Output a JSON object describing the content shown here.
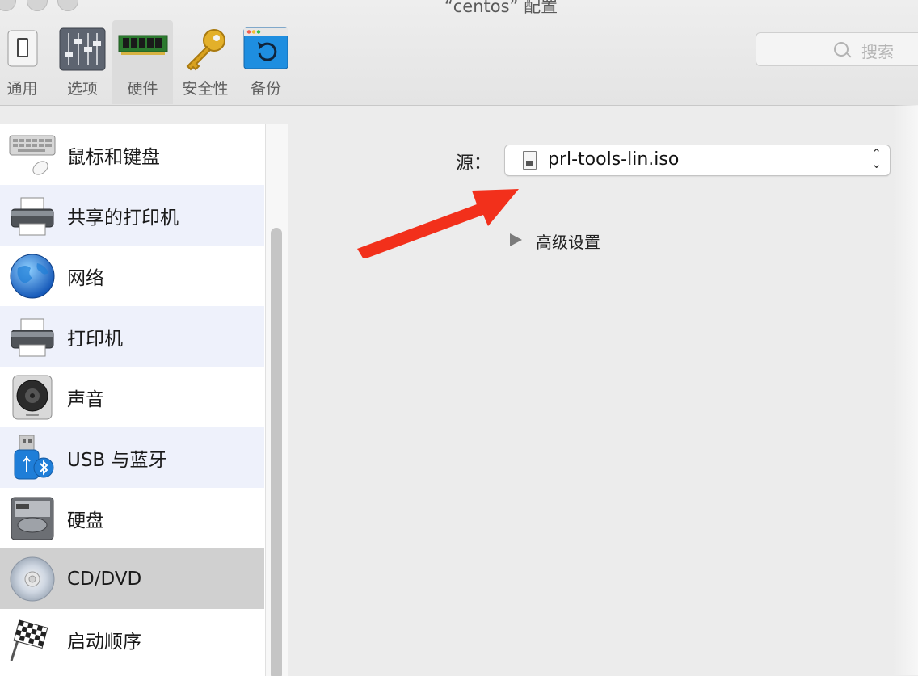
{
  "window": {
    "title": "“centos” 配置"
  },
  "toolbar": {
    "items": [
      {
        "label": "通用",
        "icon": "general-switch-icon"
      },
      {
        "label": "选项",
        "icon": "options-sliders-icon"
      },
      {
        "label": "硬件",
        "icon": "hardware-ram-icon",
        "selected": true
      },
      {
        "label": "安全性",
        "icon": "security-key-icon"
      },
      {
        "label": "备份",
        "icon": "backup-restore-icon"
      }
    ],
    "search": {
      "placeholder": "搜索"
    }
  },
  "sidebar": {
    "items": [
      {
        "label": "鼠标和键盘",
        "icon": "keyboard-mouse-icon"
      },
      {
        "label": "共享的打印机",
        "icon": "shared-printer-icon"
      },
      {
        "label": "网络",
        "icon": "globe-network-icon"
      },
      {
        "label": "打印机",
        "icon": "printer-icon"
      },
      {
        "label": "声音",
        "icon": "speaker-icon"
      },
      {
        "label": "USB 与蓝牙",
        "icon": "usb-bluetooth-icon"
      },
      {
        "label": "硬盘",
        "icon": "hard-disk-icon"
      },
      {
        "label": "CD/DVD",
        "icon": "cd-dvd-icon",
        "selected": true
      },
      {
        "label": "启动顺序",
        "icon": "checkered-flag-icon"
      }
    ]
  },
  "detail": {
    "source_label": "源：",
    "source_value": "prl-tools-lin.iso",
    "advanced_label": "高级设置"
  },
  "colors": {
    "annotation_arrow": "#f2301b",
    "selected_row": "#d0d0d0",
    "alt_row": "#eef1fb"
  }
}
